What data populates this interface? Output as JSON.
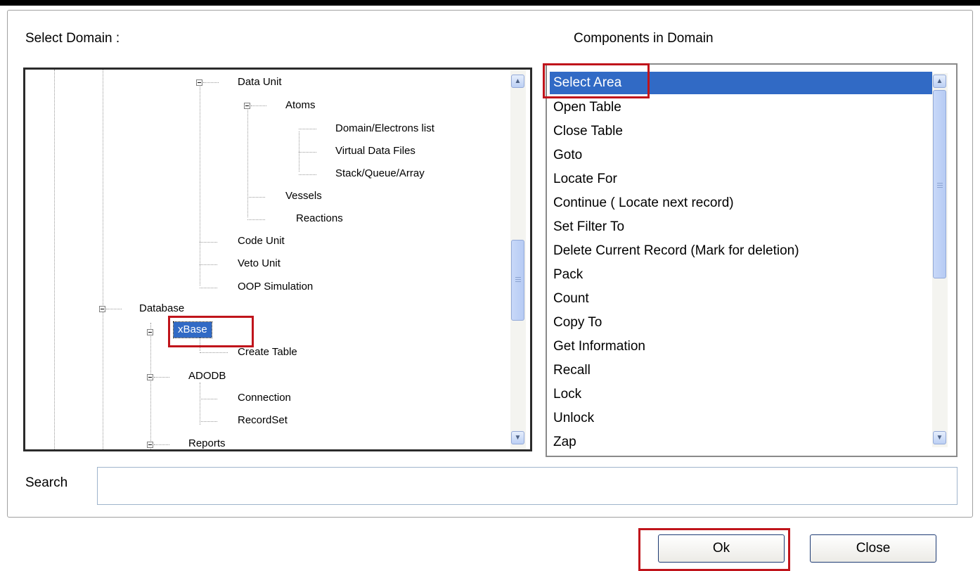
{
  "labels": {
    "select_domain": "Select Domain :",
    "components_in_domain": "Components in Domain",
    "search": "Search"
  },
  "tree": {
    "nodes": [
      {
        "label": "Data Unit",
        "expander": true
      },
      {
        "label": "Atoms",
        "expander": true
      },
      {
        "label": "Domain/Electrons list"
      },
      {
        "label": "Virtual Data Files"
      },
      {
        "label": "Stack/Queue/Array"
      },
      {
        "label": "Vessels"
      },
      {
        "label": "Reactions"
      },
      {
        "label": "Code Unit"
      },
      {
        "label": "Veto Unit"
      },
      {
        "label": "OOP Simulation"
      },
      {
        "label": "Database",
        "expander": true
      },
      {
        "label": "xBase",
        "expander": true,
        "selected": true
      },
      {
        "label": "Create Table"
      },
      {
        "label": "ADODB",
        "expander": true
      },
      {
        "label": "Connection"
      },
      {
        "label": "RecordSet"
      },
      {
        "label": "Reports",
        "expander": true
      }
    ]
  },
  "components": {
    "selected": "Select Area",
    "items": [
      "Select Area",
      "Open Table",
      "Close Table",
      "Goto",
      "Locate For",
      "Continue ( Locate next record)",
      "Set Filter To",
      "Delete Current Record (Mark for deletion)",
      "Pack",
      "Count",
      "Copy To",
      "Get Information",
      "Recall",
      "Lock",
      "Unlock",
      "Zap"
    ]
  },
  "search": {
    "value": "",
    "placeholder": ""
  },
  "buttons": {
    "ok": "Ok",
    "close": "Close"
  },
  "icons": {
    "scroll_up": "chevron-up-icon",
    "scroll_down": "chevron-down-icon",
    "tree_collapse": "minus-box-icon"
  },
  "colors": {
    "selection": "#316ac5",
    "highlight_box": "#c0141b"
  }
}
